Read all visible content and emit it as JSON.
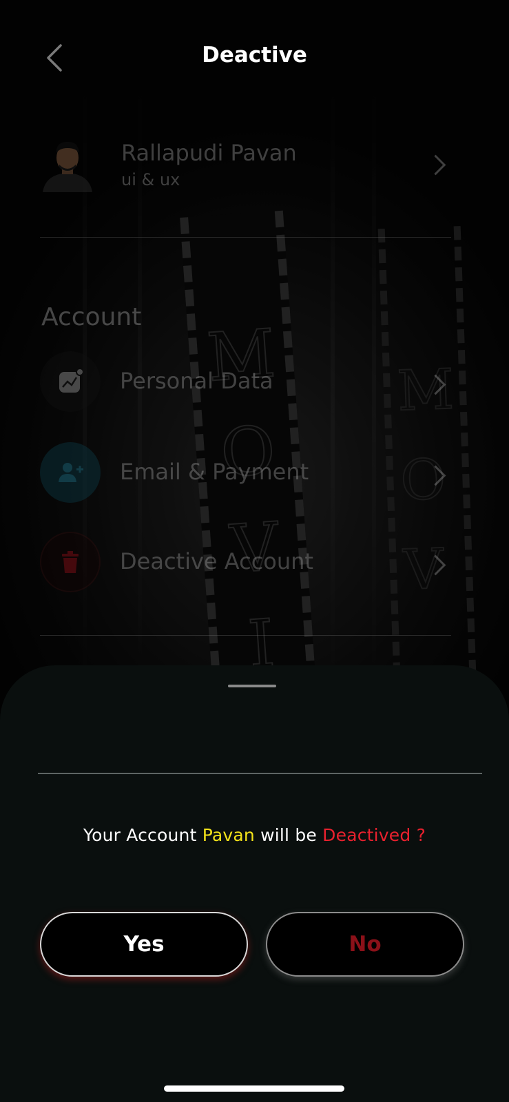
{
  "header": {
    "title": "Deactive",
    "back_icon": "chevron-left-icon"
  },
  "profile": {
    "name": "Rallapudi Pavan",
    "role": "ui & ux"
  },
  "account_section": {
    "title": "Account",
    "items": [
      {
        "label": "Personal Data",
        "icon": "chart-icon",
        "accent": "#cfcfcf"
      },
      {
        "label": "Email & Payment",
        "icon": "add-user-icon",
        "accent": "#2aa8c8"
      },
      {
        "label": "Deactive Account",
        "icon": "trash-icon",
        "accent": "#c4121c"
      }
    ]
  },
  "dialog": {
    "message_prefix": "Your Account ",
    "username": "Pavan",
    "message_middle": " will be ",
    "warning": "Deactived ?",
    "yes_label": "Yes",
    "no_label": "No"
  },
  "colors": {
    "sheet_background": "#0a0f0e",
    "highlight_yellow": "#f2e21a",
    "warning_red": "#e8212e",
    "no_button_text": "#8b1119"
  }
}
